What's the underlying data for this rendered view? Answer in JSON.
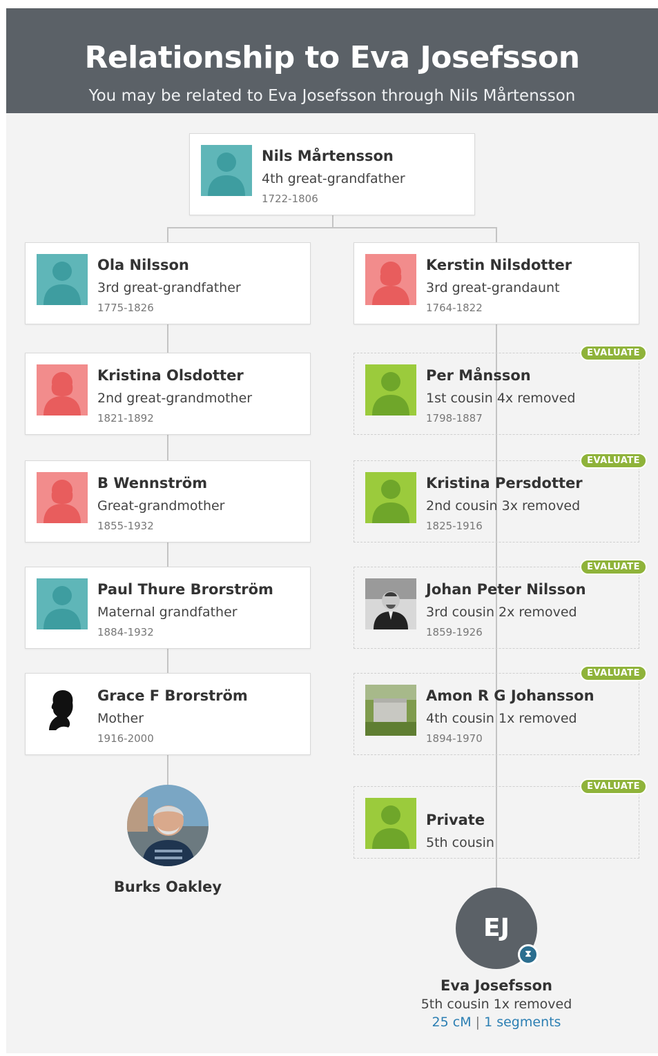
{
  "header": {
    "title": "Relationship to Eva Josefsson",
    "subtitle": "You may be related to Eva Josefsson through Nils Mårtensson"
  },
  "colors": {
    "header_bg": "#5b6167",
    "male_avatar": "#5fb6b8",
    "female_avatar": "#ef6f6f",
    "match_avatar": "#8fbc2e",
    "badge": "#8fb33a",
    "link": "#2c7fb3"
  },
  "root": {
    "name": "Nils Mårtensson",
    "relationship": "4th great-grandfather",
    "years": "1722-1806",
    "avatar": "male-silhouette-icon"
  },
  "left_line": [
    {
      "name": "Ola Nilsson",
      "relationship": "3rd great-grandfather",
      "years": "1775-1826",
      "avatar": "male-silhouette-icon"
    },
    {
      "name": "Kristina Olsdotter",
      "relationship": "2nd great-grandmother",
      "years": "1821-1892",
      "avatar": "female-silhouette-icon"
    },
    {
      "name": "B Wennström",
      "relationship": "Great-grandmother",
      "years": "1855-1932",
      "avatar": "female-silhouette-icon"
    },
    {
      "name": "Paul Thure Brorström",
      "relationship": "Maternal grandfather",
      "years": "1884-1932",
      "avatar": "male-silhouette-icon"
    },
    {
      "name": "Grace F Brorström",
      "relationship": "Mother",
      "years": "1916-2000",
      "avatar": "cameo-silhouette-icon"
    }
  ],
  "right_line": [
    {
      "name": "Kerstin Nilsdotter",
      "relationship": "3rd great-grandaunt",
      "years": "1764-1822",
      "avatar": "female-silhouette-icon"
    },
    {
      "name": "Per Månsson",
      "relationship": "1st cousin 4x removed",
      "years": "1798-1887",
      "avatar": "green-silhouette-icon",
      "badge": "EVALUATE"
    },
    {
      "name": "Kristina Persdotter",
      "relationship": "2nd cousin 3x removed",
      "years": "1825-1916",
      "avatar": "green-silhouette-icon",
      "badge": "EVALUATE"
    },
    {
      "name": "Johan Peter Nilsson",
      "relationship": "3rd cousin 2x removed",
      "years": "1859-1926",
      "avatar": "portrait-photo",
      "badge": "EVALUATE"
    },
    {
      "name": "Amon R G Johansson",
      "relationship": "4th cousin 1x removed",
      "years": "1894-1970",
      "avatar": "gravestone-photo",
      "badge": "EVALUATE"
    },
    {
      "name": "Private",
      "relationship": "5th cousin",
      "years": "",
      "avatar": "green-silhouette-icon",
      "badge": "EVALUATE"
    }
  ],
  "self": {
    "name": "Burks Oakley"
  },
  "match": {
    "initials": "EJ",
    "name": "Eva Josefsson",
    "relationship": "5th cousin 1x removed",
    "cm": "25 cM",
    "separator": "|",
    "segments": "1 segments"
  }
}
